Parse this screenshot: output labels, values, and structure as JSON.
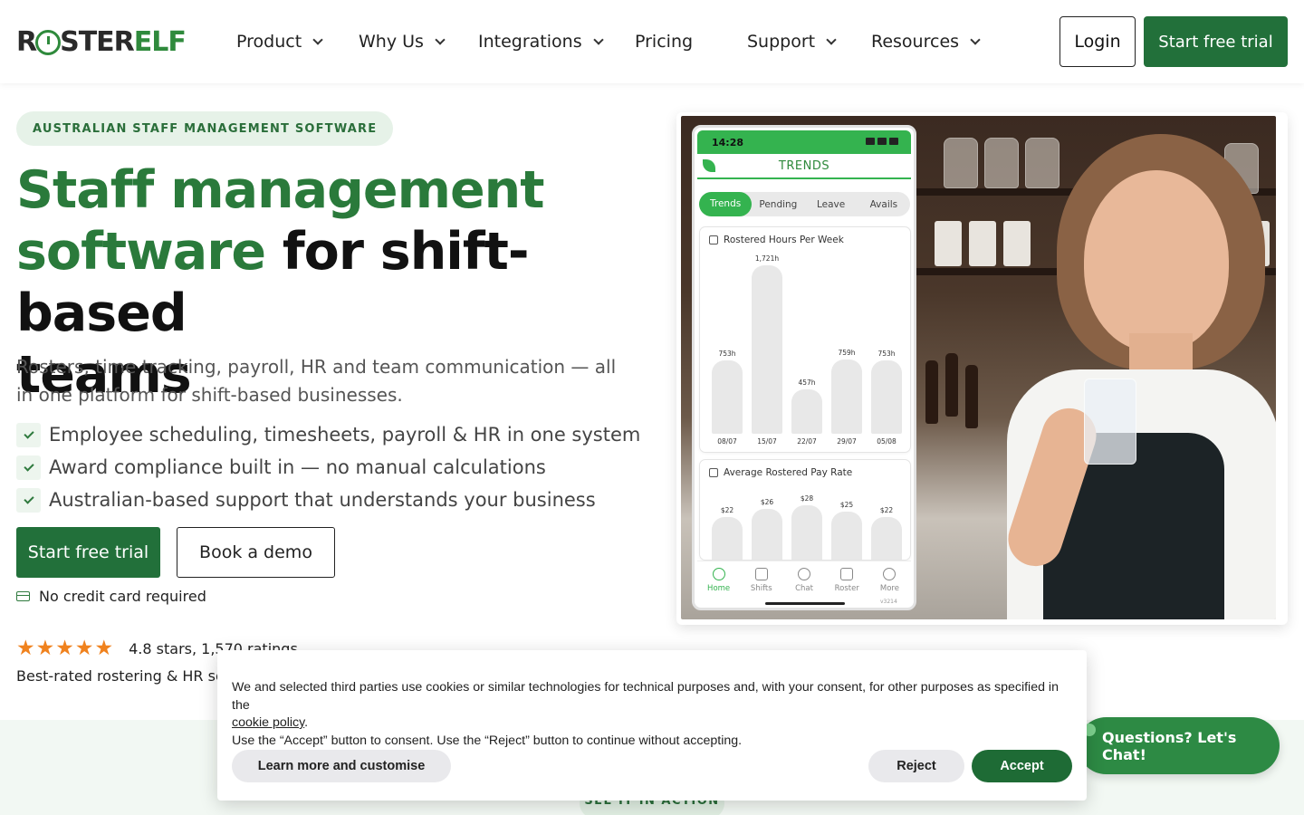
{
  "header": {
    "logo_prefix": "R",
    "logo_mid": "STER",
    "logo_suffix": "ELF",
    "nav": [
      {
        "label": "Product",
        "has_dropdown": true
      },
      {
        "label": "Why Us",
        "has_dropdown": true
      },
      {
        "label": "Integrations",
        "has_dropdown": true
      },
      {
        "label": "Pricing",
        "has_dropdown": false
      },
      {
        "label": "Support",
        "has_dropdown": true
      },
      {
        "label": "Resources",
        "has_dropdown": true
      }
    ],
    "login_label": "Login",
    "trial_label": "Start free trial"
  },
  "hero": {
    "eyebrow": "AUSTRALIAN STAFF MANAGEMENT SOFTWARE",
    "headline_green_1": "Staff management",
    "headline_green_2": "software",
    "headline_dark_1": " for shift-based",
    "headline_dark_2": "teams",
    "subtitle": "Rosters, time tracking, payroll, HR and team communication — all in one platform for shift-based businesses.",
    "checks": [
      "Employee scheduling, timesheets, payroll & HR in one system",
      "Award compliance built in — no manual calculations",
      "Australian-based support that understands your business"
    ],
    "cta_primary": "Start free trial",
    "cta_secondary": "Book a demo",
    "no_cc": "No credit card required",
    "stars": 5,
    "rating_text": "4.8 stars, 1,570 ratings",
    "best_rated": "Best-rated rostering & HR sof"
  },
  "phone": {
    "time": "14:28",
    "screen_title": "TRENDS",
    "tabs": [
      "Trends",
      "Pending",
      "Leave",
      "Avails"
    ],
    "active_tab": "Trends",
    "hours_title": "Rostered Hours Per Week",
    "pay_title": "Average Rostered Pay Rate",
    "bottom_nav": [
      "Home",
      "Shifts",
      "Chat",
      "Roster",
      "More"
    ],
    "version": "v3214"
  },
  "chart_data": [
    {
      "type": "bar",
      "title": "Rostered Hours Per Week",
      "categories": [
        "08/07",
        "15/07",
        "22/07",
        "29/07",
        "05/08"
      ],
      "values": [
        753,
        1721
      ],
      "value_labels": [
        "753h",
        "1,721h",
        "457h",
        "759h",
        "753h"
      ],
      "series": [
        {
          "values": [
            753,
            1721,
            457,
            759,
            753
          ]
        }
      ]
    },
    {
      "type": "bar",
      "title": "Average Rostered Pay Rate",
      "categories": [
        "",
        "",
        "",
        "",
        ""
      ],
      "value_labels": [
        "$22",
        "$26",
        "$28",
        "$25",
        "$22"
      ],
      "series": [
        {
          "values": [
            22,
            26,
            28,
            25,
            22
          ]
        }
      ]
    }
  ],
  "band": {
    "see_label": "SEE IT IN ACTION"
  },
  "chat": {
    "label": "Questions? Let's Chat!"
  },
  "cookie": {
    "text_1": "We and selected third parties use cookies or similar technologies for technical purposes and, with your consent, for other purposes as specified in the",
    "link": "cookie policy",
    "text_2": ".",
    "text_3": "Use the “Accept” button to consent. Use the “Reject” button to continue without accepting.",
    "learn_label": "Learn more and customise",
    "reject_label": "Reject",
    "accept_label": "Accept"
  },
  "colors": {
    "brand_green": "#22703a",
    "accent_green": "#34b34f",
    "star_orange": "#f0821e"
  }
}
